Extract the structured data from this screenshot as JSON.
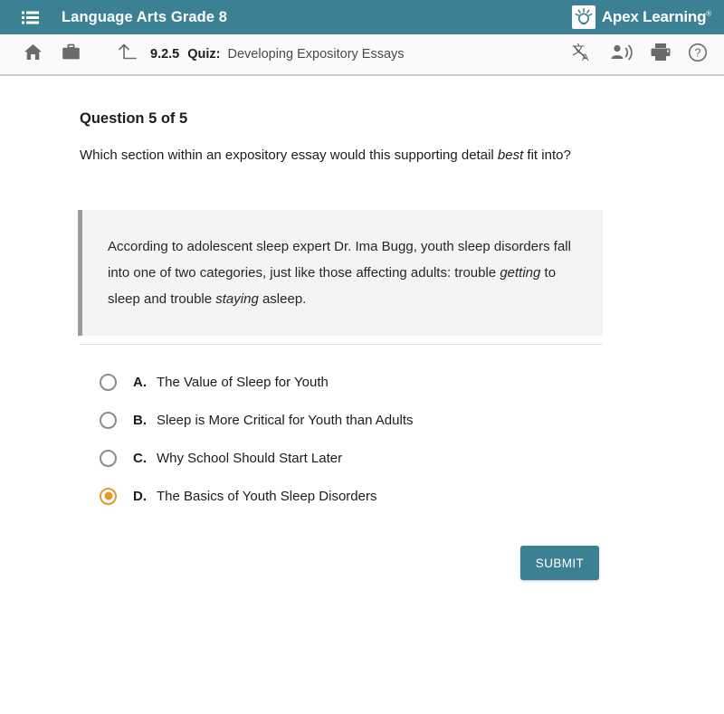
{
  "header": {
    "menu_icon": "list-menu-icon",
    "course_title": "Language Arts Grade 8",
    "brand_icon": "apex-lightbulb-logo-icon",
    "brand_name": "Apex Learning",
    "brand_trademark": "®",
    "background_color": "#3b8093"
  },
  "toolbar": {
    "home_icon": "home-icon",
    "briefcase_icon": "briefcase-icon",
    "up_level_icon": "up-arrow-icon",
    "lesson_number": "9.2.5",
    "activity_type": "Quiz:",
    "activity_name": "Developing Expository Essays",
    "translate_icon": "translate-icon",
    "read_aloud_icon": "text-to-speech-icon",
    "print_icon": "printer-icon",
    "help_icon": "help-circle-icon",
    "background_color": "#fafafa"
  },
  "main": {
    "question_heading": "Question 5 of 5",
    "question_prompt_before": "Which section within an expository essay would this supporting detail ",
    "question_prompt_emphasis": "best",
    "question_prompt_after": " fit into?",
    "passage": {
      "part1": "According to adolescent sleep expert Dr. Ima Bugg, youth sleep disorders fall into one of two categories, just like those affecting adults: trouble ",
      "emphasis1": "getting",
      "part2": " to sleep and trouble ",
      "emphasis2": "staying",
      "part3": " asleep.",
      "background_color": "#f4f4f4",
      "border_color": "#9b9b9b"
    },
    "options": [
      {
        "letter": "A.",
        "label": "The Value of Sleep for Youth",
        "selected": false
      },
      {
        "letter": "B.",
        "label": "Sleep is More Critical for Youth than Adults",
        "selected": false
      },
      {
        "letter": "C.",
        "label": "Why School Should Start Later",
        "selected": false
      },
      {
        "letter": "D.",
        "label": "The Basics of Youth Sleep Disorders",
        "selected": true
      }
    ],
    "selected_option": "D",
    "selected_color": "#e5982f",
    "submit_label": "SUBMIT",
    "submit_color": "#3b8093"
  }
}
